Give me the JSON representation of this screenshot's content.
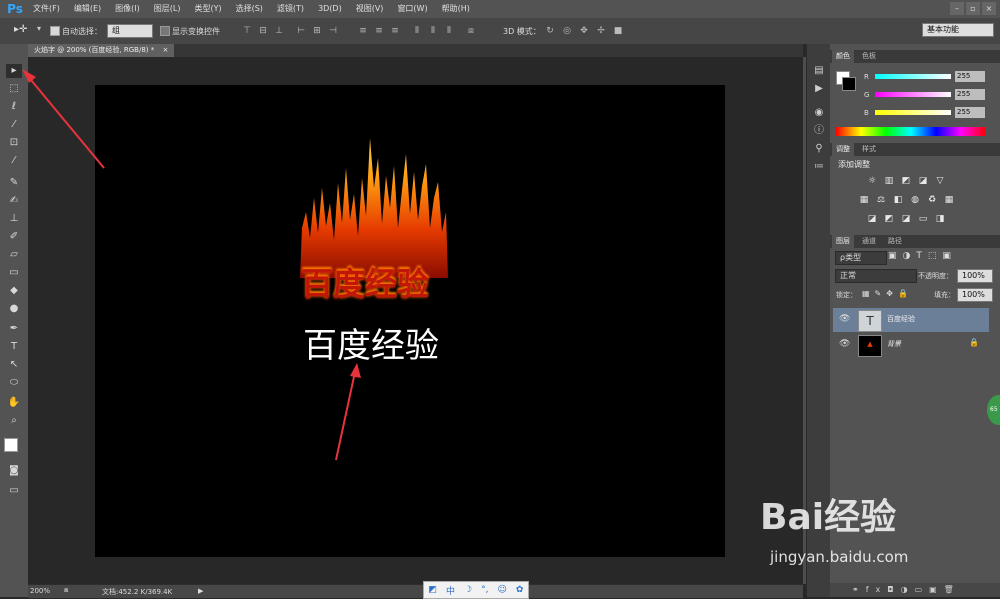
{
  "app": {
    "logo": "Ps"
  },
  "menu": [
    "文件(F)",
    "编辑(E)",
    "图像(I)",
    "图层(L)",
    "类型(Y)",
    "选择(S)",
    "滤镜(T)",
    "3D(D)",
    "视图(V)",
    "窗口(W)",
    "帮助(H)"
  ],
  "window_controls": [
    "–",
    "▫",
    "×"
  ],
  "options_bar": {
    "auto_select_label": "自动选择：",
    "auto_select_value": "组",
    "show_transform_label": "显示变换控件",
    "mode_3d_label": "3D 模式：",
    "workspace": "基本功能"
  },
  "document_tab": {
    "title": "火焰字 @ 200% (百度经验, RGB/8) *",
    "close": "×"
  },
  "canvas": {
    "fire_text": "百度经验",
    "plain_text": "百度经验"
  },
  "status_bar": {
    "zoom": "200%",
    "doc_info": "文档:452.2 K/369.4K"
  },
  "ime_bar": [
    "中",
    "☽",
    "°,",
    "☺",
    "✿"
  ],
  "color_panel": {
    "tabs": [
      "颜色",
      "色板"
    ],
    "channels": [
      {
        "label": "R",
        "value": "255",
        "color": "#00e5ff"
      },
      {
        "label": "G",
        "value": "255",
        "color": "#e040e0"
      },
      {
        "label": "B",
        "value": "255",
        "color": "#f0f000"
      }
    ]
  },
  "adjustments_panel": {
    "tabs": [
      "调整",
      "样式"
    ],
    "title": "添加调整"
  },
  "layers_panel": {
    "tabs": [
      "图层",
      "通道",
      "路径"
    ],
    "filter_label": "ρ类型",
    "blend_mode": "正常",
    "opacity_label": "不透明度：",
    "opacity_value": "100%",
    "lock_label": "锁定：",
    "fill_label": "填充：",
    "fill_value": "100%",
    "layers": [
      {
        "name": "百度经验",
        "type": "text",
        "selected": true
      },
      {
        "name": "背景",
        "type": "image",
        "selected": false
      }
    ]
  },
  "watermark": {
    "brand": "Bai经验",
    "url": "jingyan.baidu.com"
  },
  "green_badge": "65"
}
